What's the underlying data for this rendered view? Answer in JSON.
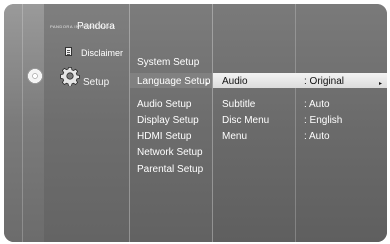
{
  "menu": {
    "brand_small": "PANDORA INTERNET RADIO",
    "brand": "Pandora",
    "disclaimer": "Disclaimer",
    "setup": "Setup"
  },
  "setup_items": [
    "System Setup",
    "Language Setup",
    "Audio Setup",
    "Display Setup",
    "HDMI Setup",
    "Network Setup",
    "Parental Setup"
  ],
  "selected_indicator": "▸",
  "language_options": [
    {
      "label": "Audio",
      "value": ": Original",
      "arrow": "▸"
    },
    {
      "label": "Subtitle",
      "value": ": Auto"
    },
    {
      "label": "Disc Menu",
      "value": ": English"
    },
    {
      "label": "Menu",
      "value": ": Auto"
    }
  ],
  "colors": {
    "highlight": "#e6e6e6",
    "text": "#ffffff",
    "selected_text": "#111111"
  },
  "icons": {
    "disc": "disc-icon",
    "setup": "gear-icon",
    "disclaimer": "document-icon"
  }
}
